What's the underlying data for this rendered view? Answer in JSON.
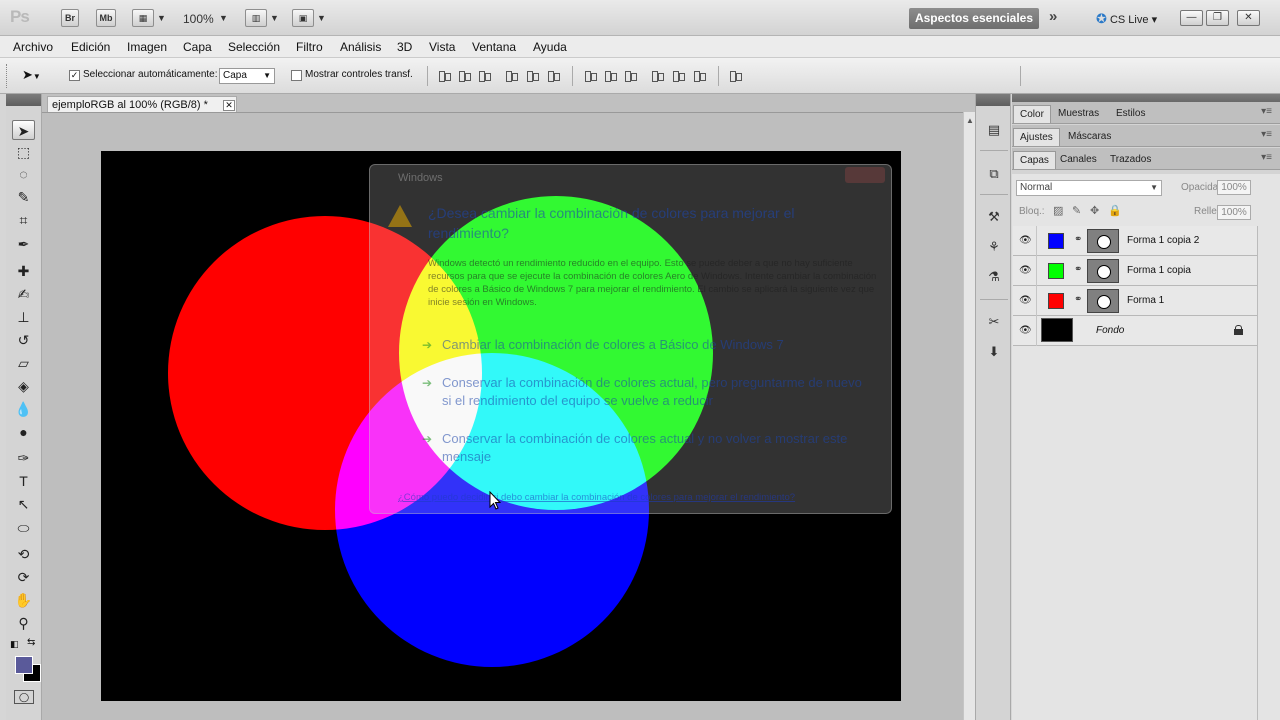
{
  "appbar": {
    "logo": "Ps",
    "bridge": "Br",
    "mini_bridge": "Mb",
    "zoom": "100%",
    "workspace": "Aspectos esenciales",
    "more": "»",
    "cs_live": "CS Live",
    "cs_live_arrow": "▾",
    "minimize": "—",
    "restore": "❐",
    "close": "✕"
  },
  "menubar": {
    "items": [
      "Archivo",
      "Edición",
      "Imagen",
      "Capa",
      "Selección",
      "Filtro",
      "Análisis",
      "3D",
      "Vista",
      "Ventana",
      "Ayuda"
    ]
  },
  "options": {
    "auto_select_label": "Seleccionar automáticamente:",
    "auto_select_checked": "✓",
    "auto_select_target": "Capa",
    "show_transform_label": "Mostrar controles transf."
  },
  "document": {
    "tab_title": "ejemploRGB al 100% (RGB/8) *",
    "tab_close": "✕",
    "canvas_bg": "#000000",
    "circles": [
      {
        "name": "red",
        "color": "#ff0000"
      },
      {
        "name": "green",
        "color": "#00ff00"
      },
      {
        "name": "blue",
        "color": "#0000ff"
      }
    ]
  },
  "dialog": {
    "title": "Windows",
    "heading": "¿Desea cambiar la combinación de colores para mejorar el rendimiento?",
    "body": "Windows detectó un rendimiento reducido en el equipo. Esto se puede deber a que no hay suficiente recursos para que se ejecute la combinación de colores Aero de Windows. Intente cambiar la combinación de colores a Básico de Windows 7 para mejorar el rendimiento. El cambio se aplicará la siguiente vez que inicie sesión en Windows.",
    "option_1": "Cambiar la combinación de colores a Básico de Windows 7",
    "option_2": "Conservar la combinación de colores actual, pero preguntarme de nuevo si el rendimiento del equipo se vuelve a reducir",
    "option_3": "Conservar la combinación de colores actual y no volver a mostrar este mensaje",
    "link": "¿Cómo puedo decidir si debo cambiar la combinación de colores para mejorar el rendimiento?"
  },
  "panels": {
    "group1_tabs": [
      "Color",
      "Muestras",
      "Estilos"
    ],
    "group2_tabs": [
      "Ajustes",
      "Máscaras"
    ],
    "group3_tabs": [
      "Capas",
      "Canales",
      "Trazados"
    ],
    "menu_icon": "▾≡"
  },
  "layers_panel": {
    "blend_mode": "Normal",
    "opacity_label": "Opacidad:",
    "opacity_value": "100%",
    "lock_label": "Bloq.:",
    "fill_label": "Relleno:",
    "fill_value": "100%",
    "layers": [
      {
        "name": "Forma 1 copia 2",
        "color": "#0000ff"
      },
      {
        "name": "Forma 1 copia",
        "color": "#00ff00"
      },
      {
        "name": "Forma 1",
        "color": "#ff0000"
      }
    ],
    "background_layer": "Fondo"
  },
  "colors": {
    "foreground": "#5a5a9a",
    "background": "#000000"
  }
}
